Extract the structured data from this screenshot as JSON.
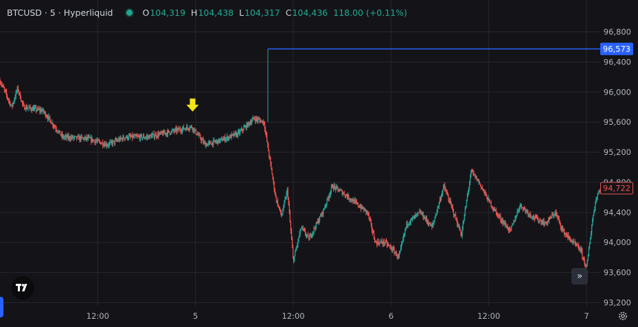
{
  "header": {
    "symbol": "BTCUSD · 5 · Hyperliquid",
    "o_label": "O",
    "o_value": "104,319",
    "h_label": "H",
    "h_value": "104,438",
    "l_label": "L",
    "l_value": "104,317",
    "c_label": "C",
    "c_value": "104,436",
    "change": "118.00 (+0.11%)"
  },
  "icons": {
    "logo": "tradingview-logo-icon",
    "scroll": "double-chevron-right-icon",
    "settings": "gear-icon",
    "marker": "arrow-down-marker-icon"
  },
  "colors": {
    "background": "#141418",
    "grid": "#26262c",
    "up": "#26a69a",
    "down": "#ef5350",
    "hline": "#2962ff",
    "marker": "#f5e416"
  },
  "chart_data": {
    "type": "candlestick",
    "y_ticks": [
      "96,800",
      "96,400",
      "96,000",
      "95,600",
      "95,200",
      "94,800",
      "94,400",
      "94,000",
      "93,600",
      "93,200"
    ],
    "y_tick_values": [
      96800,
      96400,
      96000,
      95600,
      95200,
      94800,
      94400,
      94000,
      93600,
      93200
    ],
    "ylim": [
      93150,
      96950
    ],
    "x_ticks": [
      "12:00",
      "5",
      "12:00",
      "6",
      "12:00",
      "7"
    ],
    "x_tick_values": [
      0.5,
      1.0,
      1.5,
      2.0,
      2.5,
      3.0
    ],
    "xlim": [
      0.0,
      3.07
    ],
    "price_anchors": [
      [
        0.0,
        96150
      ],
      [
        0.06,
        95800
      ],
      [
        0.09,
        96050
      ],
      [
        0.12,
        95800
      ],
      [
        0.22,
        95750
      ],
      [
        0.32,
        95400
      ],
      [
        0.45,
        95380
      ],
      [
        0.55,
        95300
      ],
      [
        0.64,
        95400
      ],
      [
        0.75,
        95400
      ],
      [
        0.87,
        95470
      ],
      [
        0.98,
        95540
      ],
      [
        1.05,
        95300
      ],
      [
        1.12,
        95350
      ],
      [
        1.22,
        95450
      ],
      [
        1.3,
        95650
      ],
      [
        1.35,
        95600
      ],
      [
        1.38,
        95100
      ],
      [
        1.41,
        94600
      ],
      [
        1.44,
        94350
      ],
      [
        1.47,
        94700
      ],
      [
        1.5,
        93750
      ],
      [
        1.54,
        94200
      ],
      [
        1.58,
        94050
      ],
      [
        1.65,
        94400
      ],
      [
        1.7,
        94750
      ],
      [
        1.76,
        94650
      ],
      [
        1.83,
        94500
      ],
      [
        1.88,
        94400
      ],
      [
        1.92,
        94000
      ],
      [
        1.97,
        94000
      ],
      [
        2.01,
        93900
      ],
      [
        2.04,
        93800
      ],
      [
        2.08,
        94250
      ],
      [
        2.15,
        94400
      ],
      [
        2.21,
        94200
      ],
      [
        2.27,
        94750
      ],
      [
        2.32,
        94400
      ],
      [
        2.36,
        94100
      ],
      [
        2.41,
        94950
      ],
      [
        2.45,
        94800
      ],
      [
        2.5,
        94550
      ],
      [
        2.55,
        94350
      ],
      [
        2.61,
        94150
      ],
      [
        2.66,
        94500
      ],
      [
        2.72,
        94350
      ],
      [
        2.79,
        94250
      ],
      [
        2.84,
        94400
      ],
      [
        2.88,
        94150
      ],
      [
        2.93,
        94000
      ],
      [
        2.97,
        93900
      ],
      [
        3.0,
        93650
      ],
      [
        3.03,
        94300
      ],
      [
        3.05,
        94600
      ],
      [
        3.07,
        94722
      ]
    ],
    "horizontal_line": {
      "value": 96573,
      "label": "96,573",
      "start_x": 1.37
    },
    "last_price": {
      "value": 94722,
      "label": "94,722"
    },
    "marker": {
      "x": 0.985,
      "y": 95640
    },
    "grid": true
  }
}
